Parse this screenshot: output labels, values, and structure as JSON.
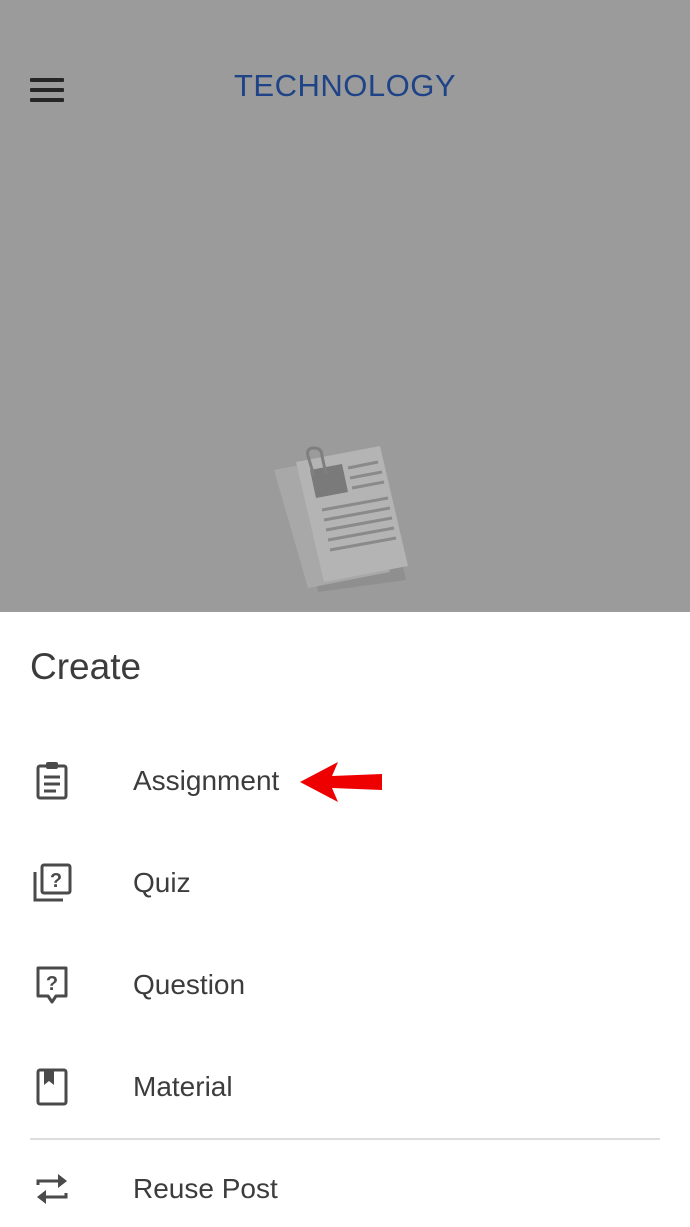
{
  "app_bar": {
    "title": "TECHNOLOGY",
    "title_color": "#1e4387",
    "menu_icon": "hamburger-menu-icon"
  },
  "background": {
    "dim_color": "#9b9b9b",
    "illustration": "documents-illustration"
  },
  "create_sheet": {
    "title": "Create",
    "items": [
      {
        "label": "Assignment",
        "icon": "assignment-icon"
      },
      {
        "label": "Quiz",
        "icon": "quiz-icon"
      },
      {
        "label": "Question",
        "icon": "question-icon"
      },
      {
        "label": "Material",
        "icon": "material-icon"
      },
      {
        "label": "Reuse Post",
        "icon": "reuse-icon"
      }
    ]
  },
  "annotation": {
    "arrow_color": "#ee0000",
    "arrow_target": "Assignment"
  }
}
